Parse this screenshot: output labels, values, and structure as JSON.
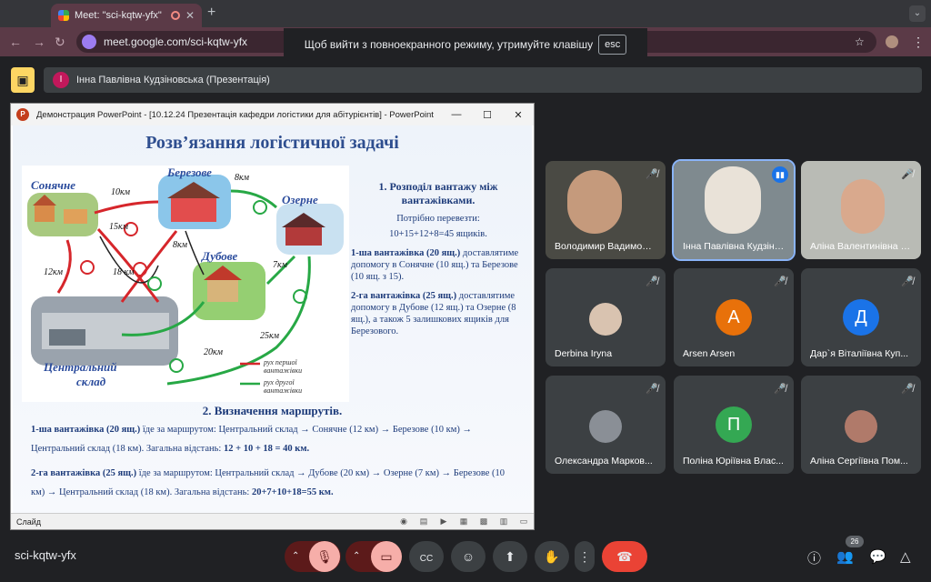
{
  "browser": {
    "tab_title": "Meet: \"sci-kqtw-yfx\"",
    "tab_close": "✕",
    "new_tab": "+",
    "url": "meet.google.com/sci-kqtw-yfx",
    "fullscreen_toast": "Щоб вийти з повноекранного режиму, утримуйте клавішу",
    "fullscreen_key": "esc"
  },
  "meet": {
    "presenter_initial": "І",
    "presenter_label": "Інна Павлівна Кудзіновська (Презентація)",
    "meeting_code": "sci-kqtw-yfx",
    "participants_count": "26",
    "accent": "#1a73e8",
    "leave_color": "#ea4335"
  },
  "powerpoint": {
    "window_title": "Демонстрация PowerPoint - [10.12.24 Презентація кафедри логістики для абітурієнтів] - PowerPoint",
    "status_label": "Слайд"
  },
  "slide": {
    "title": "Розв’язання логістичної задачі",
    "map_labels": {
      "sonyachne": "Сонячне",
      "berezove": "Березове",
      "ozerne": "Озерне",
      "dubove": "Дубове",
      "central1": "Центральний",
      "central2": "склад"
    },
    "distances": [
      "10км",
      "15км",
      "8км",
      "7км",
      "12км",
      "18 км",
      "8км",
      "20км",
      "25км"
    ],
    "route_numbers": [
      "1",
      "2",
      "3",
      "4",
      "1",
      "2",
      "3"
    ],
    "legend_red": "рух першої вантажівки",
    "legend_green": "рух другої вантажівки",
    "section1_title": "1.   Розподіл вантажу між вантажівками.",
    "need_label": "Потрібно перевезти:",
    "need_formula": "10+15+12+8=45 ящиків.",
    "truck1_head": "1-ша вантажівка (20 ящ.)",
    "truck1_text": "доставлятиме допомогу в Сонячне (10 ящ.) та Березове (10 ящ. з 15).",
    "truck2_head": "2-га вантажівка (25 ящ.)",
    "truck2_text": "доставлятиме допомогу в Дубове (12 ящ.) та Озерне (8 ящ.), а також 5 залишкових ящиків для Березового.",
    "section2_title": "2.   Визначення маршрутів.",
    "route1_head": "1-ша вантажівка (20 ящ.)",
    "route1_text": " їде за маршрутом:  Центральний склад → Сонячне (12 км) → Березове (10 км) → Центральний склад (18 км). Загальна відстань: ",
    "route1_total": "12 + 10 + 18 = 40 км.",
    "route2_head": "2-га вантажівка (25 ящ.)",
    "route2_text": "  їде за маршрутом: Центральний склад → Дубове (20 км) → Озерне (7 км) → Березове (10 км) → Центральний склад (18 км). Загальна відстань: ",
    "route2_total": "20+7+10+18=55 км."
  },
  "tiles": [
    {
      "name": "Володимир Вадимович",
      "initial": ""
    },
    {
      "name": "Інна Павлівна Кудзіновська",
      "initial": ""
    },
    {
      "name": "Аліна Валентинівна Т...",
      "initial": ""
    },
    {
      "name": "Derbina Iryna",
      "initial": ""
    },
    {
      "name": "Arsen Arsen",
      "initial": "A",
      "color": "#e8710a"
    },
    {
      "name": "Дар`я Віталіївна Куп...",
      "initial": "Д",
      "color": "#1a73e8"
    },
    {
      "name": "Олександра Марков...",
      "initial": ""
    },
    {
      "name": "Поліна Юріївна Влас...",
      "initial": "П",
      "color": "#34a853"
    },
    {
      "name": "Аліна Сергіївна Пом...",
      "initial": ""
    }
  ]
}
